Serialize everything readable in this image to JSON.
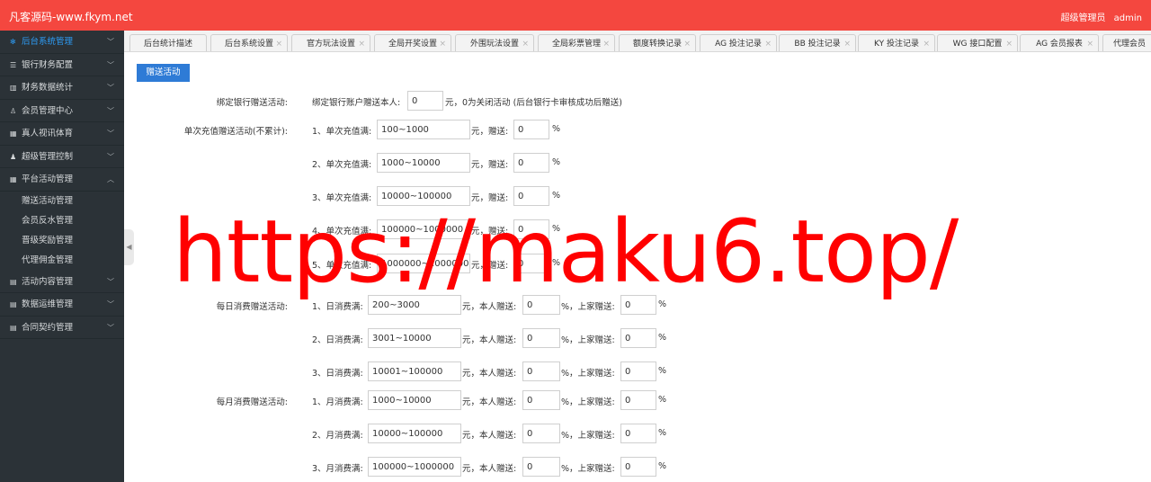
{
  "header": {
    "brand": "凡客源码-www.fkym.net",
    "role": "超级管理员",
    "username": "admin"
  },
  "sidebar": {
    "items": [
      {
        "label": "后台系统管理",
        "icon": "gear-icon",
        "glyph": "✻",
        "chevron": "﹀"
      },
      {
        "label": "银行财务配置",
        "icon": "list-icon",
        "glyph": "☰",
        "chevron": "﹀"
      },
      {
        "label": "财务数据统计",
        "icon": "bar-chart-icon",
        "glyph": "▥",
        "chevron": "﹀"
      },
      {
        "label": "会员管理中心",
        "icon": "user-icon",
        "glyph": "♙",
        "chevron": "﹀"
      },
      {
        "label": "真人视讯体育",
        "icon": "gift-icon",
        "glyph": "▦",
        "chevron": "﹀"
      },
      {
        "label": "超级管理控制",
        "icon": "person-icon",
        "glyph": "♟",
        "chevron": "﹀"
      },
      {
        "label": "平台活动管理",
        "icon": "gift-icon",
        "glyph": "▦",
        "chevron": "︿"
      },
      {
        "label": "活动内容管理",
        "icon": "folder-icon",
        "glyph": "▤",
        "chevron": "﹀"
      },
      {
        "label": "数据运维管理",
        "icon": "folder-icon",
        "glyph": "▤",
        "chevron": "﹀"
      },
      {
        "label": "合同契约管理",
        "icon": "folder-icon",
        "glyph": "▤",
        "chevron": "﹀"
      }
    ],
    "submenu": [
      "赠送活动管理",
      "会员反水管理",
      "晋级奖励管理",
      "代理佣金管理"
    ],
    "collapse_glyph": "◀"
  },
  "tabs": [
    "后台统计描述",
    "后台系统设置",
    "官方玩法设置",
    "全局开奖设置",
    "外围玩法设置",
    "全局彩票管理",
    "额度转换记录",
    "AG 投注记录",
    "BB 投注记录",
    "KY 投注记录",
    "WG 接口配置",
    "AG 会员报表",
    "代理会员"
  ],
  "tab_close": "×",
  "main": {
    "button": "赠送活动",
    "bind_bank": {
      "label": "绑定银行赠送活动:",
      "prefix": "绑定银行账户赠送本人:",
      "value": "0",
      "suffix": "元，0为关闭活动 (后台银行卡审核成功后赠送)"
    },
    "single_recharge": {
      "label": "单次充值赠送活动(不累计):",
      "rows": [
        {
          "prefix": "1、单次充值满:",
          "range": "100~1000",
          "unit": "元，赠送:",
          "value": "0",
          "pct": "%"
        },
        {
          "prefix": "2、单次充值满:",
          "range": "1000~10000",
          "unit": "元，赠送:",
          "value": "0",
          "pct": "%"
        },
        {
          "prefix": "3、单次充值满:",
          "range": "10000~100000",
          "unit": "元，赠送:",
          "value": "0",
          "pct": "%"
        },
        {
          "prefix": "4、单次充值满:",
          "range": "100000~1000000",
          "unit": "元，赠送:",
          "value": "0",
          "pct": "%"
        },
        {
          "prefix": "5、单次充值满:",
          "range": "1000000~10000000",
          "unit": "元，赠送:",
          "value": "0",
          "pct": "%"
        }
      ]
    },
    "daily": {
      "label": "每日消费赠送活动:",
      "rows": [
        {
          "prefix": "1、日消费满:",
          "range": "200~3000",
          "unit": "元，本人赠送:",
          "self": "0",
          "pct": "%，上家赠送:",
          "upper": "0",
          "pct2": "%"
        },
        {
          "prefix": "2、日消费满:",
          "range": "3001~10000",
          "unit": "元，本人赠送:",
          "self": "0",
          "pct": "%，上家赠送:",
          "upper": "0",
          "pct2": "%"
        },
        {
          "prefix": "3、日消费满:",
          "range": "10001~100000",
          "unit": "元，本人赠送:",
          "self": "0",
          "pct": "%，上家赠送:",
          "upper": "0",
          "pct2": "%"
        }
      ]
    },
    "monthly": {
      "label": "每月消费赠送活动:",
      "rows": [
        {
          "prefix": "1、月消费满:",
          "range": "1000~10000",
          "unit": "元，本人赠送:",
          "self": "0",
          "pct": "%，上家赠送:",
          "upper": "0",
          "pct2": "%"
        },
        {
          "prefix": "2、月消费满:",
          "range": "10000~100000",
          "unit": "元，本人赠送:",
          "self": "0",
          "pct": "%，上家赠送:",
          "upper": "0",
          "pct2": "%"
        },
        {
          "prefix": "3、月消费满:",
          "range": "100000~1000000",
          "unit": "元，本人赠送:",
          "self": "0",
          "pct": "%，上家赠送:",
          "upper": "0",
          "pct2": "%"
        }
      ]
    }
  },
  "watermark": "https://maku6.top/",
  "colors": {
    "header": "#f4473f",
    "sidebar": "#2b3237",
    "active": "#2d9cf5",
    "button": "#2e7bd6",
    "watermark": "#ff0000"
  }
}
